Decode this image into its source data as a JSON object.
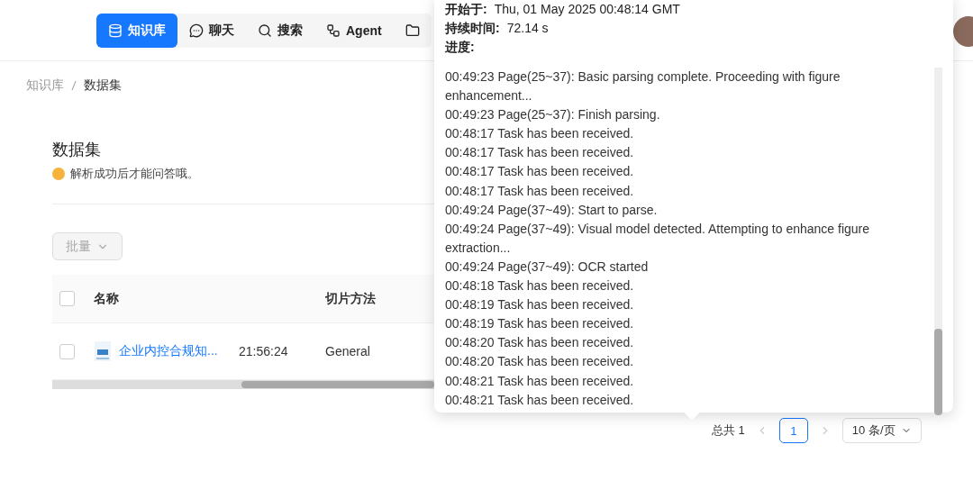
{
  "nav": [
    {
      "label": "知识库",
      "selected": true
    },
    {
      "label": "聊天",
      "selected": false
    },
    {
      "label": "搜索",
      "selected": false
    },
    {
      "label": "Agent",
      "selected": false
    },
    {
      "selected": false
    }
  ],
  "breadcrumb": [
    "知识库",
    "数据集"
  ],
  "page": {
    "title": "数据集",
    "hint": "解析成功后才能问答哦。"
  },
  "batch_button": "批量",
  "table": {
    "columns": [
      "名称",
      "",
      "切片方法"
    ],
    "rows": [
      {
        "checked": false,
        "name": "企业内控合规知...",
        "column_2": "21:56:24",
        "method": "General"
      }
    ],
    "header_checked": false
  },
  "pagination": {
    "total": "总共 1",
    "page": "1",
    "page_size": "10 条/页"
  },
  "popover": {
    "fields": [
      {
        "label": "开始于:",
        "value": "Thu, 01 May 2025 00:48:14 GMT"
      },
      {
        "label": "持续时间:",
        "value": "72.14 s"
      },
      {
        "label": "进度:"
      }
    ],
    "log": [
      "00:49:23 Page(25~37): Basic parsing complete. Proceeding with figure enhancement...",
      "00:49:23 Page(25~37): Finish parsing.",
      "00:48:17 Task has been received.",
      "00:48:17 Task has been received.",
      "00:48:17 Task has been received.",
      "00:48:17 Task has been received.",
      "00:49:24 Page(37~49): Start to parse.",
      "00:49:24 Page(37~49): Visual model detected. Attempting to enhance figure extraction...",
      "00:49:24 Page(37~49): OCR started",
      "00:48:18 Task has been received.",
      "00:48:19 Task has been received.",
      "00:48:19 Task has been received.",
      "00:48:20 Task has been received.",
      "00:48:20 Task has been received.",
      "00:48:21 Task has been received.",
      "00:48:21 Task has been received."
    ]
  }
}
